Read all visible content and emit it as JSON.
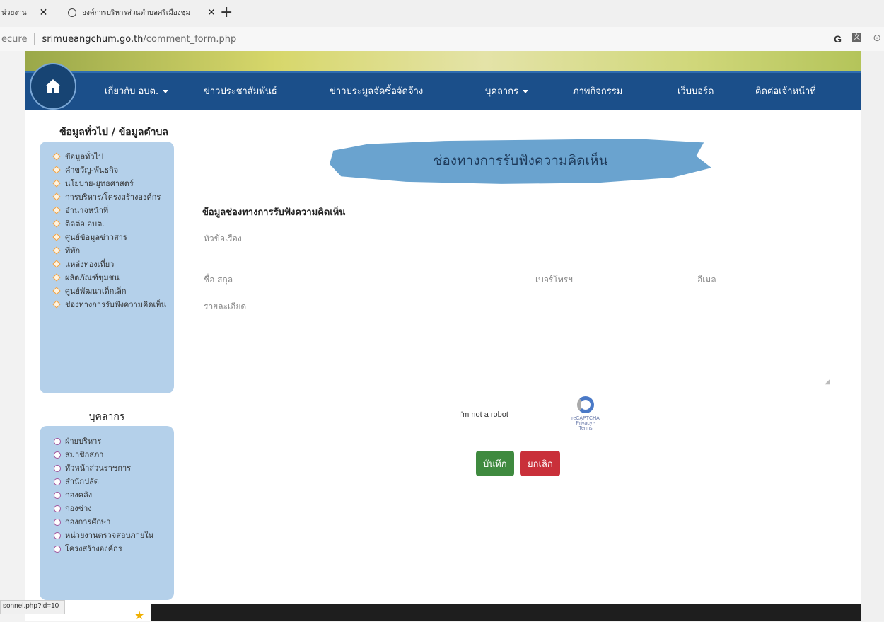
{
  "browser": {
    "tabs": [
      {
        "title": "น่วยงาน"
      },
      {
        "title": "องค์การบริหารส่วนตำบลศรีเมืองชุม"
      }
    ],
    "new_tab": "+",
    "close": "✕",
    "security": "ecure",
    "url_host": "srimueangchum.go.th",
    "url_path": "/comment_form.php",
    "status_url": "sonnel.php?id=10"
  },
  "nav": {
    "items": [
      {
        "label": "เกี่ยวกับ อบต.",
        "dropdown": true
      },
      {
        "label": "ข่าวประชาสัมพันธ์"
      },
      {
        "label": "ข่าวประมูลจัดซื้อจัดจ้าง"
      },
      {
        "label": "บุคลากร",
        "dropdown": true
      },
      {
        "label": "ภาพกิจกรรม"
      },
      {
        "label": "เว็บบอร์ด"
      },
      {
        "label": "ติดต่อเจ้าหน้าที่"
      }
    ]
  },
  "sidebar": {
    "general_title": "ข้อมูลทั่วไป / ข้อมูลตำบล",
    "general_items": [
      "ข้อมูลทั่วไป",
      "คำขวัญ-พันธกิจ",
      "นโยบาย-ยุทธศาสตร์",
      "การบริหาร/โครงสร้างองค์กร",
      "อำนาจหน้าที่",
      "ติดต่อ อบต.",
      "ศูนย์ข้อมูลข่าวสาร",
      "ที่พัก",
      "แหล่งท่องเที่ยว",
      "ผลิตภัณฑ์ชุมชน",
      "ศูนย์พัฒนาเด็กเล็ก",
      "ช่องทางการรับฟังความคิดเห็น"
    ],
    "personnel_title": "บุคลากร",
    "personnel_items": [
      "ฝ่ายบริหาร",
      "สมาชิกสภา",
      "หัวหน้าส่วนราชการ",
      "สำนักปลัด",
      "กองคลัง",
      "กองช่าง",
      "กองการศึกษา",
      "หน่วยงานตรวจสอบภายใน",
      "โครงสร้างองค์กร"
    ]
  },
  "main": {
    "banner_title": "ช่องทางการรับฟังความคิดเห็น",
    "section_title": "ข้อมูลช่องทางการรับฟังความคิดเห็น",
    "subject_placeholder": "หัวข้อเรื่อง",
    "name_placeholder": "ชื่อ สกุล",
    "phone_placeholder": "เบอร์โทรฯ",
    "email_placeholder": "อีเมล",
    "detail_placeholder": "รายละเอียด",
    "recaptcha_label": "I'm not a robot",
    "recaptcha_brand": "reCAPTCHA",
    "recaptcha_links": "Privacy - Terms",
    "save_label": "บันทึก",
    "cancel_label": "ยกเลิก"
  },
  "colors": {
    "nav": "#1b4f8a",
    "sidebar": "#b4d0ea",
    "save": "#3f8a3f",
    "cancel": "#c9303a",
    "brush": "#6aa3cf"
  }
}
